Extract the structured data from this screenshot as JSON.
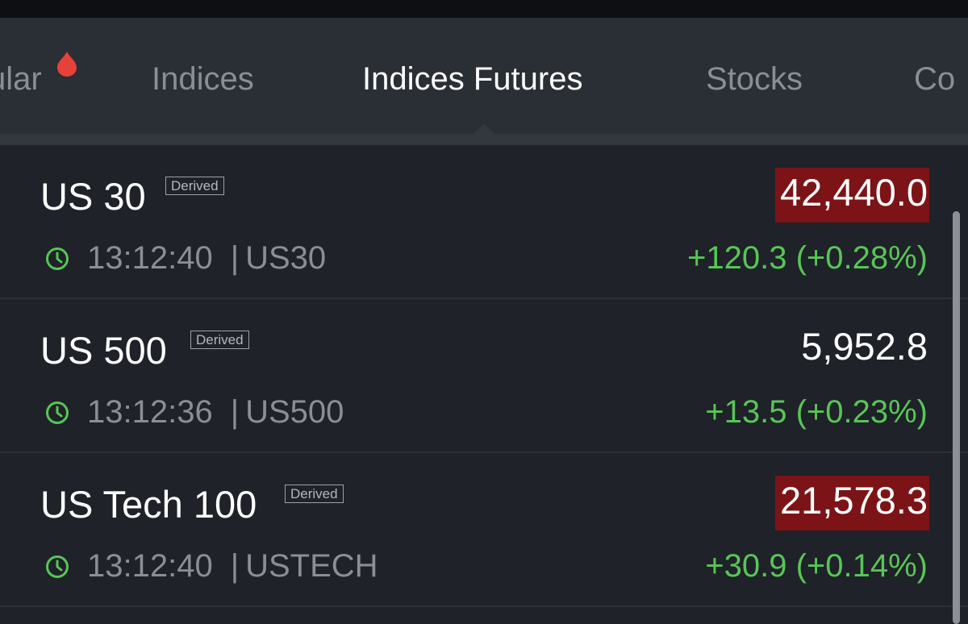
{
  "tabs": [
    {
      "label": "ular",
      "hot": true,
      "active": false
    },
    {
      "label": "Indices",
      "active": false
    },
    {
      "label": "Indices Futures",
      "active": true
    },
    {
      "label": "Stocks",
      "active": false
    },
    {
      "label": "Co",
      "active": false
    }
  ],
  "badge_label": "Derived",
  "instruments": [
    {
      "name": "US 30",
      "time": "13:12:40",
      "separator": "|",
      "symbol": "US30",
      "price": "42,440.0",
      "price_highlight": "#7c1417",
      "change": "+120.3 (+0.28%)"
    },
    {
      "name": "US 500",
      "time": "13:12:36",
      "separator": "|",
      "symbol": "US500",
      "price": "5,952.8",
      "price_highlight": null,
      "change": "+13.5 (+0.23%)"
    },
    {
      "name": "US Tech 100",
      "time": "13:12:40",
      "separator": "|",
      "symbol": "USTECH",
      "price": "21,578.3",
      "price_highlight": "#7c1417",
      "change": "+30.9 (+0.14%)"
    }
  ],
  "icons": {
    "hot": "flame-icon",
    "time": "clock-icon"
  },
  "colors": {
    "background": "#1f2228",
    "tab_bar": "#2a2e35",
    "up": "#58c557",
    "down_highlight": "#7c1417",
    "hot_icon": "#e8413a"
  }
}
